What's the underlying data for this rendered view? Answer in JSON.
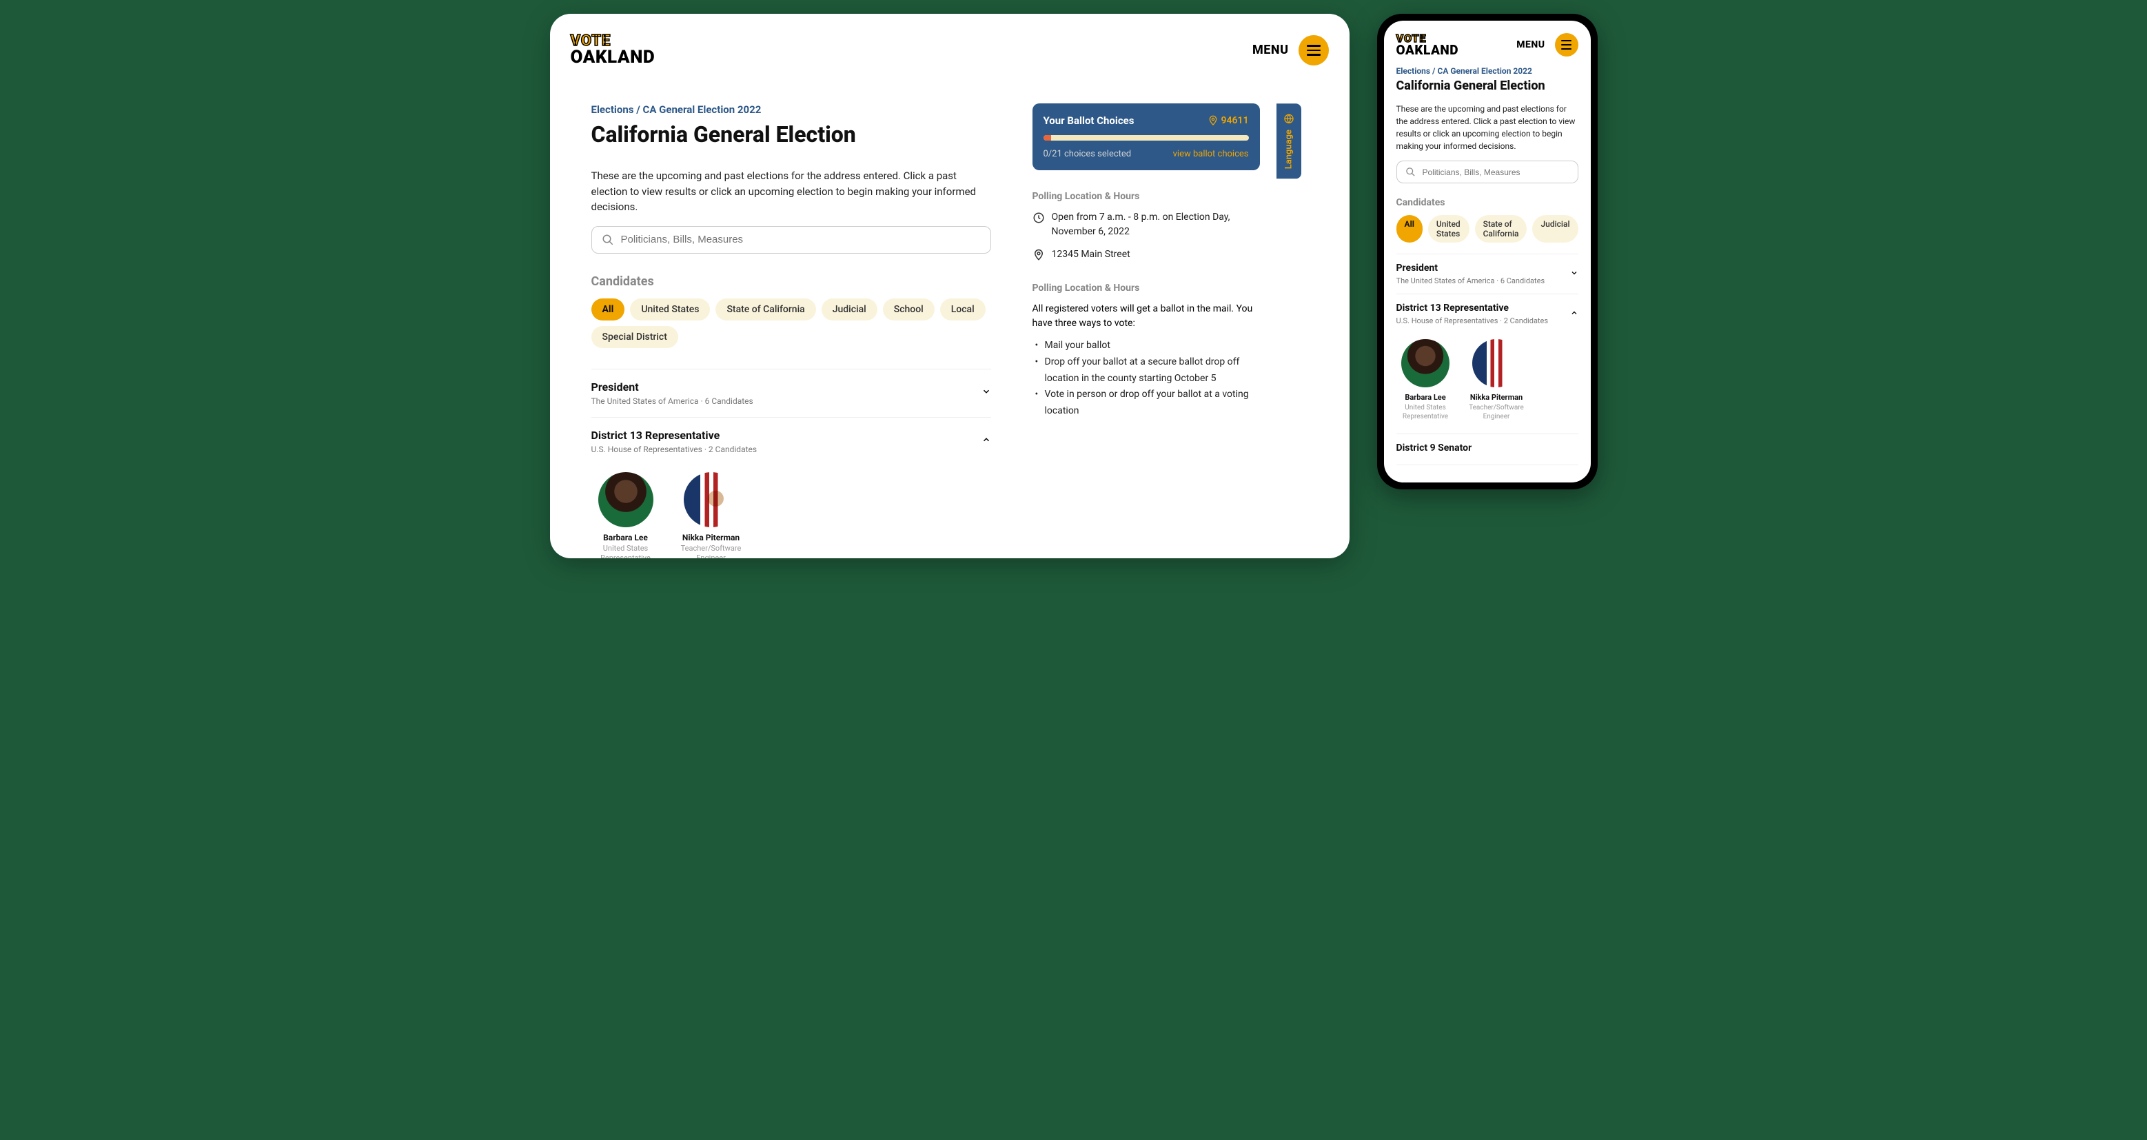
{
  "brand": {
    "line1": "VOTE",
    "line2": "OAKLAND"
  },
  "menu": {
    "label": "MENU"
  },
  "breadcrumb": {
    "item1": "Elections",
    "sep": "/",
    "item2": "CA General Election 2022"
  },
  "page_title": "California General Election",
  "intro": "These are the upcoming and past elections for the address entered. Click a past election to view results or click an upcoming election to begin making your informed decisions.",
  "search": {
    "placeholder": "Politicians, Bills, Measures"
  },
  "candidates_label": "Candidates",
  "filters": {
    "all": "All",
    "us": "United States",
    "ca": "State of California",
    "jud": "Judicial",
    "sch": "School",
    "loc": "Local",
    "sd": "Special District"
  },
  "races": {
    "president": {
      "title": "President",
      "sub": "The United States of America · 6 Candidates"
    },
    "district13": {
      "title": "District 13 Representative",
      "sub": "U.S. House of Representatives · 2 Candidates"
    },
    "district9": {
      "title": "District 9 Senator"
    }
  },
  "cands": {
    "c1": {
      "name": "Barbara Lee",
      "role": "United States Representative"
    },
    "c2": {
      "name": "Nikka Piterman",
      "role": "Teacher/Software Engineer"
    }
  },
  "ballot": {
    "title": "Your Ballot Choices",
    "zip": "94611",
    "count": "0/21 choices selected",
    "link": "view ballot choices"
  },
  "lang_tab": "Language",
  "poll1": {
    "title": "Polling Location & Hours",
    "hours": "Open from 7 a.m. - 8 p.m. on Election Day, November 6, 2022",
    "addr": "12345 Main Street"
  },
  "poll2": {
    "title": "Polling Location & Hours",
    "intro": "All registered voters will get a ballot in the mail. You have three ways to vote:",
    "opt1": "Mail your ballot",
    "opt2": "Drop off your ballot at a secure ballot drop off location in the county starting October 5",
    "opt3": "Vote in person or drop off your ballot at a voting location"
  }
}
